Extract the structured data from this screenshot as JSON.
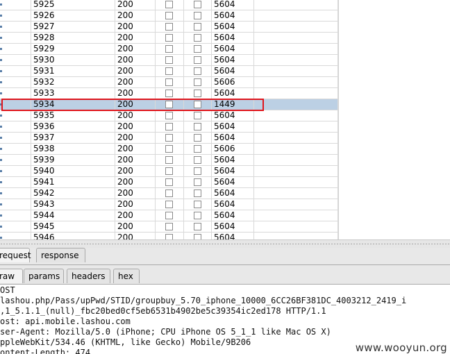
{
  "table": {
    "rows": [
      {
        "num": "5925",
        "status": "200",
        "length": "5604",
        "selected": false
      },
      {
        "num": "5926",
        "status": "200",
        "length": "5604",
        "selected": false
      },
      {
        "num": "5927",
        "status": "200",
        "length": "5604",
        "selected": false
      },
      {
        "num": "5928",
        "status": "200",
        "length": "5604",
        "selected": false
      },
      {
        "num": "5929",
        "status": "200",
        "length": "5604",
        "selected": false
      },
      {
        "num": "5930",
        "status": "200",
        "length": "5604",
        "selected": false
      },
      {
        "num": "5931",
        "status": "200",
        "length": "5604",
        "selected": false
      },
      {
        "num": "5932",
        "status": "200",
        "length": "5606",
        "selected": false
      },
      {
        "num": "5933",
        "status": "200",
        "length": "5604",
        "selected": false
      },
      {
        "num": "5934",
        "status": "200",
        "length": "1449",
        "selected": true
      },
      {
        "num": "5935",
        "status": "200",
        "length": "5604",
        "selected": false
      },
      {
        "num": "5936",
        "status": "200",
        "length": "5604",
        "selected": false
      },
      {
        "num": "5937",
        "status": "200",
        "length": "5604",
        "selected": false
      },
      {
        "num": "5938",
        "status": "200",
        "length": "5606",
        "selected": false
      },
      {
        "num": "5939",
        "status": "200",
        "length": "5604",
        "selected": false
      },
      {
        "num": "5940",
        "status": "200",
        "length": "5604",
        "selected": false
      },
      {
        "num": "5941",
        "status": "200",
        "length": "5604",
        "selected": false
      },
      {
        "num": "5942",
        "status": "200",
        "length": "5604",
        "selected": false
      },
      {
        "num": "5943",
        "status": "200",
        "length": "5604",
        "selected": false
      },
      {
        "num": "5944",
        "status": "200",
        "length": "5604",
        "selected": false
      },
      {
        "num": "5945",
        "status": "200",
        "length": "5604",
        "selected": false
      },
      {
        "num": "5946",
        "status": "200",
        "length": "5604",
        "selected": false
      }
    ]
  },
  "tabs_primary": [
    {
      "label": "request",
      "active": true
    },
    {
      "label": "response",
      "active": false
    }
  ],
  "tabs_secondary": [
    {
      "label": "raw",
      "active": true
    },
    {
      "label": "params",
      "active": false
    },
    {
      "label": "headers",
      "active": false
    },
    {
      "label": "hex",
      "active": false
    }
  ],
  "request_lines": [
    "OST",
    "lashou.php/Pass/upPwd/STID/groupbuy_5.70_iphone_10000_6CC26BF381DC_4003212_2419_i",
    ",1_5.1.1_(null)_fbc20bed0cf5eb6531b4902be5c39354ic2ed178 HTTP/1.1",
    "ost: api.mobile.lashou.com",
    "ser-Agent: Mozilla/5.0 (iPhone; CPU iPhone OS 5_1_1 like Mac OS X)",
    "ppleWebKit/534.46 (KHTML, like Gecko) Mobile/9B206",
    "ontent-Length: 474"
  ],
  "watermark": "www.wooyun.org",
  "colors": {
    "selection": "#bcd0e4",
    "highlight_border": "#e0141b"
  }
}
